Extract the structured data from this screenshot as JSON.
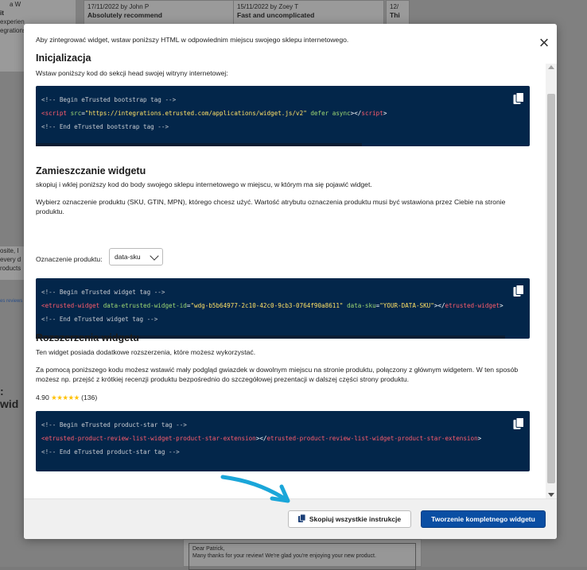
{
  "background": {
    "cards": [
      {
        "meta": "17/11/2022 by John P",
        "title": "Absolutely recommend"
      },
      {
        "meta": "15/11/2022 by Zoey T",
        "title": "Fast and uncomplicated"
      },
      {
        "meta": "12/",
        "title": "Thi"
      }
    ],
    "left_snippets": {
      "top": [
        "a W",
        "it",
        "experien",
        "egrations."
      ],
      "mid": [
        "osite, I",
        "every d",
        "roducts"
      ],
      "heading": ": wid",
      "link": "es reviews"
    },
    "reply": {
      "greeting": "Dear Patrick,",
      "message": "Many thanks for your review! We're glad you're enjoying your new product."
    }
  },
  "modal": {
    "intro": "Aby zintegrować widget, wstaw poniższy HTML w odpowiednim miejscu swojego sklepu internetowego.",
    "sections": {
      "init": {
        "title": "Inicjalizacja",
        "desc": "Wstaw poniższy kod do sekcji head swojej witryny internetowej:",
        "code": {
          "comment1": "<!-- Begin eTrusted bootstrap tag -->",
          "tag_open": "<script",
          "attr_src": " src",
          "eq": "=",
          "src_value": "\"https://integrations.etrusted.com/applications/widget.js/v2\"",
          "attr_defer": " defer async",
          "close_open": "></",
          "tag_name": "script",
          "close_end": ">",
          "comment2": "<!-- End eTrusted bootstrap tag -->"
        }
      },
      "placement": {
        "title": "Zamieszczanie widgetu",
        "desc": "skopiuj i wklej poniższy kod do body swojego sklepu internetowego w miejscu, w którym ma się pojawić widget.",
        "desc2": "Wybierz oznaczenie produktu (SKU, GTIN, MPN), którego chcesz użyć. Wartość atrybutu oznaczenia produktu musi być wstawiona przez Ciebie na stronie produktu.",
        "select_label": "Oznaczenie produktu:",
        "select_value": "data-sku",
        "code": {
          "comment1": "<!-- Begin eTrusted widget tag -->",
          "tag_open": "<etrusted-widget",
          "attr_id": " data-etrusted-widget-id",
          "eq": "=",
          "id_value": "\"wdg-b5b64977-2c10-42c0-9cb3-0764f90a8611\"",
          "attr_sku": " data-sku",
          "sku_value": "\"YOUR-DATA-SKU\"",
          "close_open": "></",
          "tag_name": "etrusted-widget",
          "close_end": ">",
          "comment2": "<!-- End eTrusted widget tag -->"
        }
      },
      "extensions": {
        "title": "Rozszerzenia widgetu",
        "desc": "Ten widget posiada dodatkowe rozszerzenia, które możesz wykorzystać.",
        "desc2": "Za pomocą poniższego kodu możesz wstawić mały podgląd gwiazdek w dowolnym miejscu na stronie produktu, połączony z głównym widgetem. W ten sposób możesz np. przejść z krótkiej recenzji produktu bezpośrednio do szczegółowej prezentacji w dalszej części strony produktu.",
        "rating_value": "4.90",
        "rating_stars": "★★★★★",
        "rating_count": "(136)",
        "code": {
          "comment1": "<!-- Begin eTrusted product-star tag -->",
          "tag_open": "<etrusted-product-review-list-widget-product-star-extension",
          "close_open": "></",
          "tag_name": "etrusted-product-review-list-widget-product-star-extension",
          "close_end": ">",
          "comment2": "<!-- End eTrusted product-star tag -->"
        }
      }
    },
    "footer": {
      "copy_all_label": "Skopiuj wszystkie instrukcje",
      "create_widget_label": "Tworzenie kompletnego widgetu"
    },
    "colors": {
      "code_bg": "#03264a",
      "primary": "#0a4ea3",
      "arrow": "#1aa6d9"
    },
    "icons": [
      "close-icon",
      "copy-icon",
      "arrow-annotation"
    ]
  }
}
